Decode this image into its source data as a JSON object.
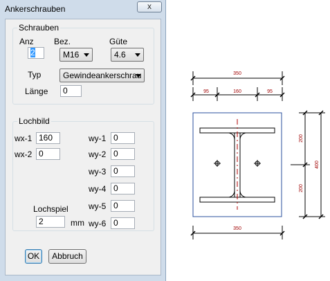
{
  "dialog": {
    "title": "Ankerschrauben",
    "close_glyph": "x"
  },
  "schrauben": {
    "group_title": "Schrauben",
    "anz_label": "Anz",
    "anz_value": "2",
    "bez_label": "Bez.",
    "bez_value": "M16",
    "guete_label": "Güte",
    "guete_value": "4.6",
    "typ_label": "Typ",
    "typ_value": "Gewindeankerschrau",
    "laenge_label": "Länge",
    "laenge_value": "0"
  },
  "lochbild": {
    "group_title": "Lochbild",
    "wx": [
      {
        "label": "wx-1",
        "value": "160"
      },
      {
        "label": "wx-2",
        "value": "0"
      }
    ],
    "wy": [
      {
        "label": "wy-1",
        "value": "0"
      },
      {
        "label": "wy-2",
        "value": "0"
      },
      {
        "label": "wy-3",
        "value": "0"
      },
      {
        "label": "wy-4",
        "value": "0"
      },
      {
        "label": "wy-5",
        "value": "0"
      },
      {
        "label": "wy-6",
        "value": "0"
      }
    ],
    "lochspiel_label": "Lochspiel",
    "lochspiel_value": "2",
    "lochspiel_unit": "mm"
  },
  "buttons": {
    "ok": "OK",
    "abbruch": "Abbruch"
  },
  "drawing": {
    "dim_total_top": "350",
    "dim_left": "95",
    "dim_middle": "160",
    "dim_right": "95",
    "dim_total_bottom": "350",
    "dim_upper": "200",
    "dim_lower": "200",
    "dim_height": "400",
    "dim_color": "#a00000",
    "plate_color": "#2a4f9e",
    "section_color": "#b00000"
  }
}
